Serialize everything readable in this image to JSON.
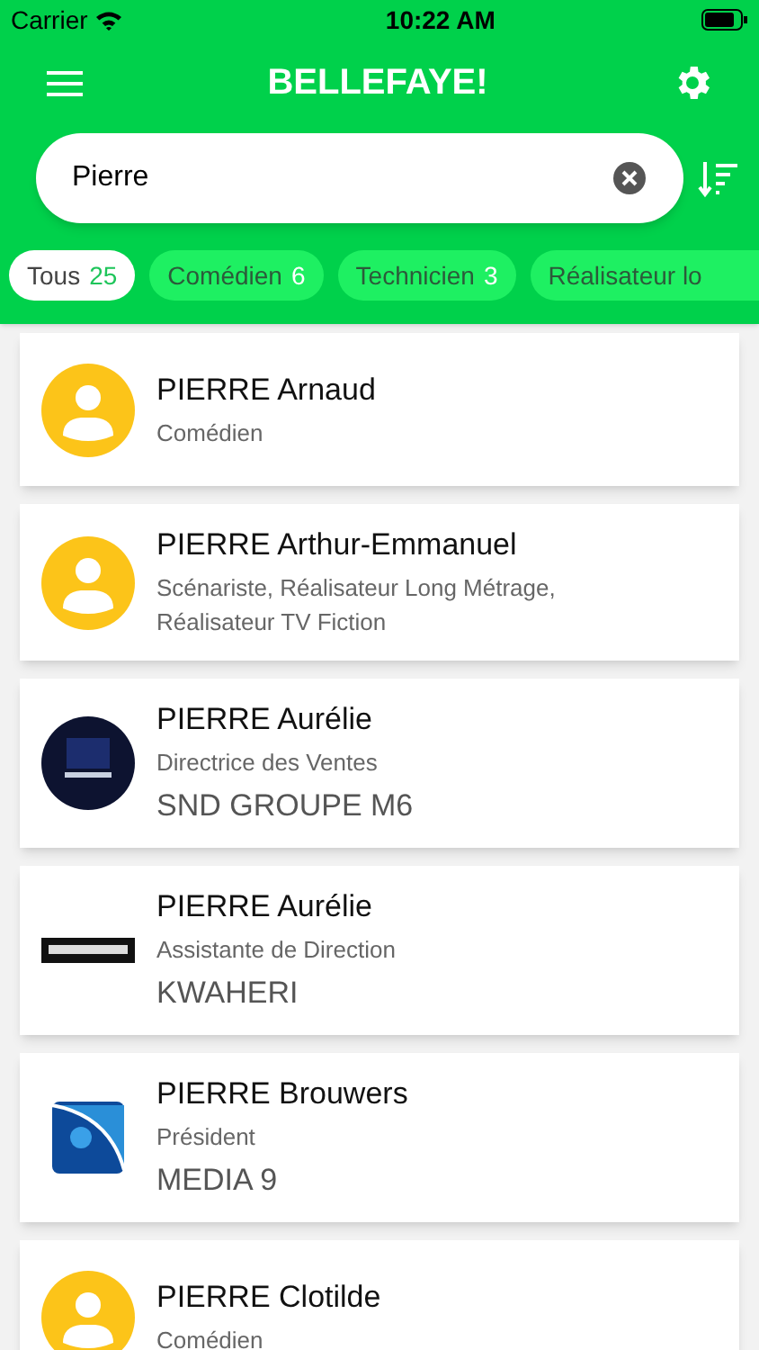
{
  "status_bar": {
    "carrier": "Carrier",
    "time": "10:22 AM"
  },
  "header": {
    "title": "BELLEFAYE!"
  },
  "search": {
    "value": "Pierre"
  },
  "filters": [
    {
      "label": "Tous",
      "count": "25",
      "selected": true
    },
    {
      "label": "Comédien",
      "count": "6",
      "selected": false
    },
    {
      "label": "Technicien",
      "count": "3",
      "selected": false
    },
    {
      "label": "Réalisateur lo",
      "selected": false
    }
  ],
  "contacts": [
    {
      "name": "PIERRE Arnaud",
      "role": "Comédien",
      "avatar": {
        "kind": "person"
      }
    },
    {
      "name": "PIERRE Arthur-Emmanuel",
      "role": "Scénariste, Réalisateur Long Métrage, Réalisateur TV Fiction",
      "avatar": {
        "kind": "person"
      }
    },
    {
      "name": "PIERRE Aurélie",
      "role": "Directrice des Ventes",
      "company": "SND GROUPE M6",
      "avatar": {
        "kind": "dark-round-logo"
      }
    },
    {
      "name": "PIERRE Aurélie",
      "role": "Assistante de Direction",
      "company": "KWAHERI",
      "avatar": {
        "kind": "bar-logo"
      }
    },
    {
      "name": "PIERRE Brouwers",
      "role": "Président",
      "company": "MEDIA 9",
      "avatar": {
        "kind": "square-logo"
      }
    },
    {
      "name": "PIERRE Clotilde",
      "role": "Comédien",
      "avatar": {
        "kind": "person"
      }
    }
  ]
}
